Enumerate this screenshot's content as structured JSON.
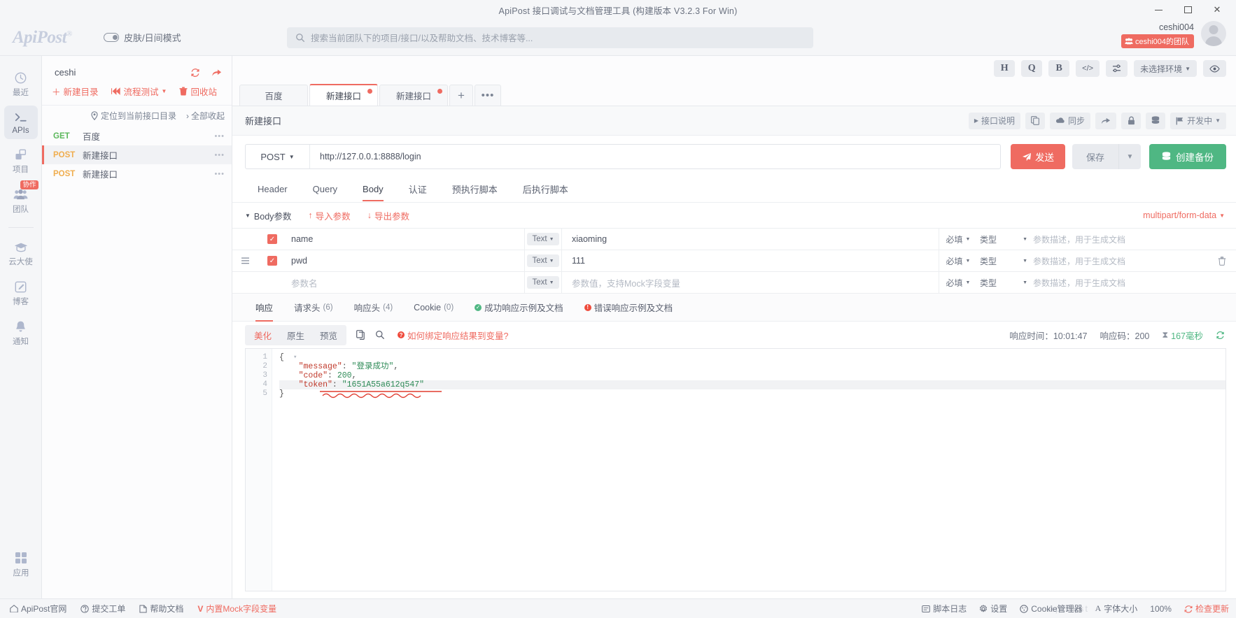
{
  "window": {
    "title": "ApiPost 接口调试与文档管理工具  (构建版本 V3.2.3 For Win)",
    "minimize": "−",
    "maximize": "□",
    "close": "✕"
  },
  "header": {
    "logo": "ApiPost",
    "logo_mark": "®",
    "skin_toggle": "皮肤/日间模式",
    "search_placeholder": "搜索当前团队下的项目/接口/以及帮助文档、技术博客等...",
    "user_name": "ceshi004",
    "team_badge": "ceshi004的团队"
  },
  "rail": {
    "items": [
      {
        "label": "最近",
        "icon": "clock-icon",
        "active": false,
        "tag": ""
      },
      {
        "label": "APIs",
        "icon": "terminal-icon",
        "active": true,
        "tag": ""
      },
      {
        "label": "项目",
        "icon": "projects-icon",
        "active": false,
        "tag": ""
      },
      {
        "label": "团队",
        "icon": "team-icon",
        "active": false,
        "tag": "协作"
      }
    ],
    "items2": [
      {
        "label": "云大使",
        "icon": "graduation-cap-icon"
      },
      {
        "label": "博客",
        "icon": "edit-square-icon"
      },
      {
        "label": "通知",
        "icon": "bell-icon"
      }
    ],
    "bottom": {
      "label": "应用",
      "icon": "grid-icon"
    }
  },
  "tree": {
    "project": "ceshi",
    "refresh_icon": "refresh-icon",
    "share_icon": "share-icon",
    "actions": [
      {
        "label": "新建目录",
        "icon": "plus-icon"
      },
      {
        "label": "流程测试",
        "icon": "flow-icon",
        "caret": true
      },
      {
        "label": "回收站",
        "icon": "trash-icon"
      }
    ],
    "sub": [
      {
        "label": "定位到当前接口目录",
        "icon": "locate-icon"
      },
      {
        "label": "全部收起",
        "icon": "chevron-right-icon"
      }
    ],
    "rows": [
      {
        "method": "GET",
        "name": "百度",
        "selected": false
      },
      {
        "method": "POST",
        "name": "新建接口",
        "selected": true
      },
      {
        "method": "POST",
        "name": "新建接口",
        "selected": false
      }
    ],
    "dots": "•••"
  },
  "util_bar": {
    "buttons": [
      {
        "label": "H",
        "name": "header-shortcut-button"
      },
      {
        "label": "Q",
        "name": "query-shortcut-button"
      },
      {
        "label": "B",
        "name": "body-shortcut-button"
      },
      {
        "label": "</>",
        "name": "code-shortcut-button"
      },
      {
        "label": "⇌",
        "name": "settings-sliders-button"
      }
    ],
    "environment": "未选择环境",
    "eye_icon": "eye-icon"
  },
  "tabs": {
    "items": [
      {
        "label": "百度",
        "active": false,
        "dirty": false
      },
      {
        "label": "新建接口",
        "active": true,
        "dirty": true
      },
      {
        "label": "新建接口",
        "active": false,
        "dirty": true
      }
    ],
    "add": "+",
    "more": "•••"
  },
  "api_bar": {
    "title": "新建接口",
    "tools": [
      {
        "label": "接口说明",
        "icon": "play-icon",
        "name": "api-description-button"
      },
      {
        "label": "",
        "icon": "copy-icon",
        "name": "copy-button"
      },
      {
        "label": "同步",
        "icon": "cloud-sync-icon",
        "name": "sync-button"
      },
      {
        "label": "",
        "icon": "share-arrow-icon",
        "name": "share-button"
      },
      {
        "label": "",
        "icon": "lock-icon",
        "name": "lock-button"
      },
      {
        "label": "",
        "icon": "database-icon",
        "name": "database-button"
      },
      {
        "label": "开发中",
        "icon": "flag-icon",
        "name": "status-dropdown",
        "caret": true
      }
    ]
  },
  "url": {
    "method": "POST",
    "value": "http://127.0.0.1:8888/login",
    "send": "发送",
    "save": "保存",
    "backup": "创建备份"
  },
  "req_tabs": [
    {
      "label": "Header",
      "active": false
    },
    {
      "label": "Query",
      "active": false
    },
    {
      "label": "Body",
      "active": true
    },
    {
      "label": "认证",
      "active": false
    },
    {
      "label": "预执行脚本",
      "active": false
    },
    {
      "label": "后执行脚本",
      "active": false
    }
  ],
  "body_params": {
    "title": "Body参数",
    "import": "导入参数",
    "export": "导出参数",
    "content_type": "multipart/form-data",
    "col_type_default": "Text",
    "col_required_default": "必填",
    "col_kind_default": "类型",
    "desc_placeholder": "参数描述，用于生成文档",
    "rows": [
      {
        "checked": true,
        "name": "name",
        "type": "Text",
        "value": "xiaoming",
        "required": "必填",
        "kind": "类型",
        "desc": "参数描述，用于生成文档",
        "placeholder": false,
        "has_delete": false,
        "has_drag": false
      },
      {
        "checked": true,
        "name": "pwd",
        "type": "Text",
        "value": "111",
        "required": "必填",
        "kind": "类型",
        "desc": "参数描述，用于生成文档",
        "placeholder": false,
        "has_delete": true,
        "has_drag": true
      },
      {
        "checked": false,
        "name": "参数名",
        "type": "Text",
        "value": "参数值，支持Mock字段变量",
        "required": "必填",
        "kind": "类型",
        "desc": "参数描述，用于生成文档",
        "placeholder": true,
        "has_delete": false,
        "has_drag": false
      }
    ]
  },
  "response_tabs": [
    {
      "label": "响应",
      "count": "",
      "active": true,
      "icon": ""
    },
    {
      "label": "请求头",
      "count": "(6)",
      "active": false,
      "icon": ""
    },
    {
      "label": "响应头",
      "count": "(4)",
      "active": false,
      "icon": ""
    },
    {
      "label": "Cookie",
      "count": "(0)",
      "active": false,
      "icon": ""
    },
    {
      "label": "成功响应示例及文档",
      "count": "",
      "active": false,
      "icon": "check-circle-icon"
    },
    {
      "label": "错误响应示例及文档",
      "count": "",
      "active": false,
      "icon": "error-circle-icon"
    }
  ],
  "viewer": {
    "modes": [
      {
        "label": "美化",
        "active": true
      },
      {
        "label": "原生",
        "active": false
      },
      {
        "label": "预览",
        "active": false
      }
    ],
    "copy_icon": "copy-doc-icon",
    "search_icon": "search-icon",
    "hint": "如何绑定响应结果到变量?",
    "time_label": "响应时间：10:01:47",
    "status_label": "响应码：200",
    "duration_label": "167毫秒",
    "refresh_icon": "refresh-icon"
  },
  "code": {
    "lines": [
      "1",
      "2",
      "3",
      "4",
      "5"
    ],
    "content": [
      {
        "n": 1,
        "text": "{",
        "fold": true
      },
      {
        "n": 2,
        "key": "\"message\"",
        "sep": ": ",
        "val": "\"登录成功\"",
        "tail": ","
      },
      {
        "n": 3,
        "key": "\"code\"",
        "sep": ": ",
        "val": "200",
        "tail": ","
      },
      {
        "n": 4,
        "key": "\"token\"",
        "sep": ": ",
        "val": "\"1651A55a612q547\"",
        "tail": "",
        "highlight": true
      },
      {
        "n": 5,
        "text": "}"
      }
    ]
  },
  "footer": {
    "left": [
      {
        "label": "ApiPost官网",
        "icon": "home-icon"
      },
      {
        "label": "提交工单",
        "icon": "ticket-icon"
      },
      {
        "label": "帮助文档",
        "icon": "doc-icon"
      },
      {
        "label": "内置Mock字段变量",
        "icon": "mock-icon",
        "accent": true
      }
    ],
    "right": [
      {
        "label": "脚本日志",
        "icon": "log-icon"
      },
      {
        "label": "设置",
        "icon": "gear-icon"
      },
      {
        "label": "Cookie管理器",
        "icon": "cookie-icon"
      },
      {
        "label": "字体大小",
        "icon": "font-size-icon"
      },
      {
        "label": "100%",
        "icon": ""
      },
      {
        "label": "检查更新",
        "icon": "update-icon",
        "accent": true
      }
    ],
    "watermark": "ApiPost"
  }
}
